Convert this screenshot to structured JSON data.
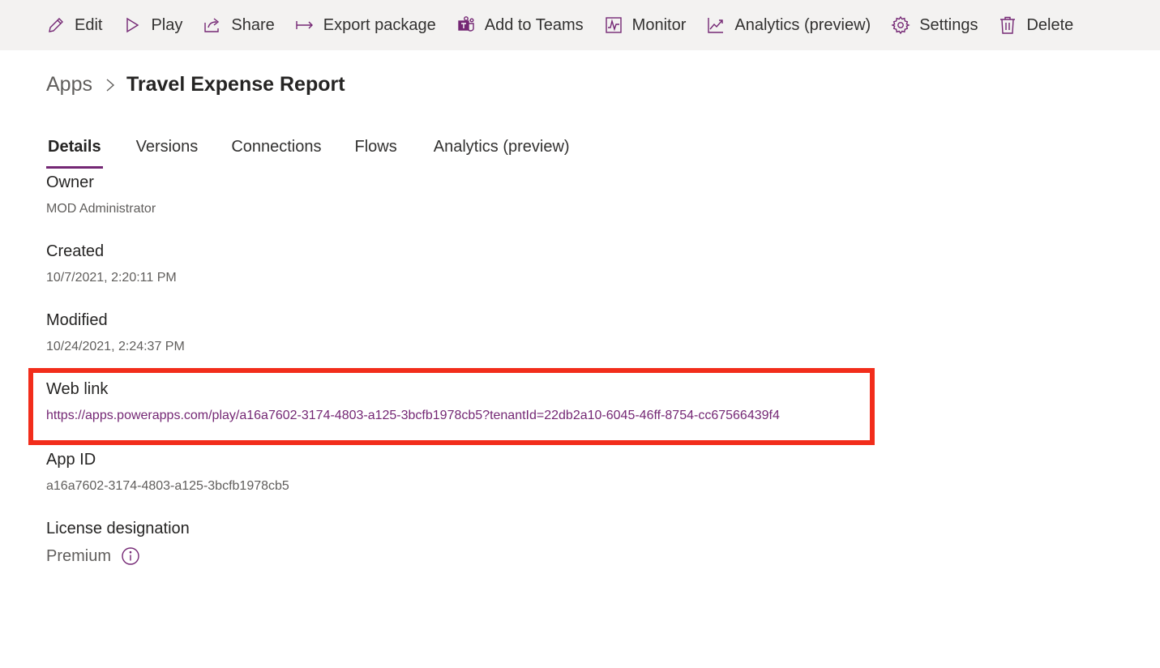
{
  "toolbar": {
    "items": [
      {
        "label": "Edit",
        "icon": "pencil-icon"
      },
      {
        "label": "Play",
        "icon": "play-icon"
      },
      {
        "label": "Share",
        "icon": "share-icon"
      },
      {
        "label": "Export package",
        "icon": "export-icon"
      },
      {
        "label": "Add to Teams",
        "icon": "teams-icon"
      },
      {
        "label": "Monitor",
        "icon": "monitor-icon"
      },
      {
        "label": "Analytics (preview)",
        "icon": "analytics-icon"
      },
      {
        "label": "Settings",
        "icon": "gear-icon"
      },
      {
        "label": "Delete",
        "icon": "trash-icon"
      }
    ]
  },
  "breadcrumb": {
    "root": "Apps",
    "current": "Travel Expense Report"
  },
  "tabs": [
    {
      "label": "Details",
      "active": true
    },
    {
      "label": "Versions",
      "active": false
    },
    {
      "label": "Connections",
      "active": false
    },
    {
      "label": "Flows",
      "active": false
    },
    {
      "label": "Analytics (preview)",
      "active": false
    }
  ],
  "details": {
    "owner": {
      "label": "Owner",
      "value": "MOD Administrator"
    },
    "created": {
      "label": "Created",
      "value": "10/7/2021, 2:20:11 PM"
    },
    "modified": {
      "label": "Modified",
      "value": "10/24/2021, 2:24:37 PM"
    },
    "web_link": {
      "label": "Web link",
      "value": "https://apps.powerapps.com/play/a16a7602-3174-4803-a125-3bcfb1978cb5?tenantId=22db2a10-6045-46ff-8754-cc67566439f4"
    },
    "app_id": {
      "label": "App ID",
      "value": "a16a7602-3174-4803-a125-3bcfb1978cb5"
    },
    "license": {
      "label": "License designation",
      "value": "Premium"
    }
  },
  "colors": {
    "accent": "#742774",
    "highlight_border": "#f22d1b",
    "toolbar_bg": "#f3f2f1"
  }
}
